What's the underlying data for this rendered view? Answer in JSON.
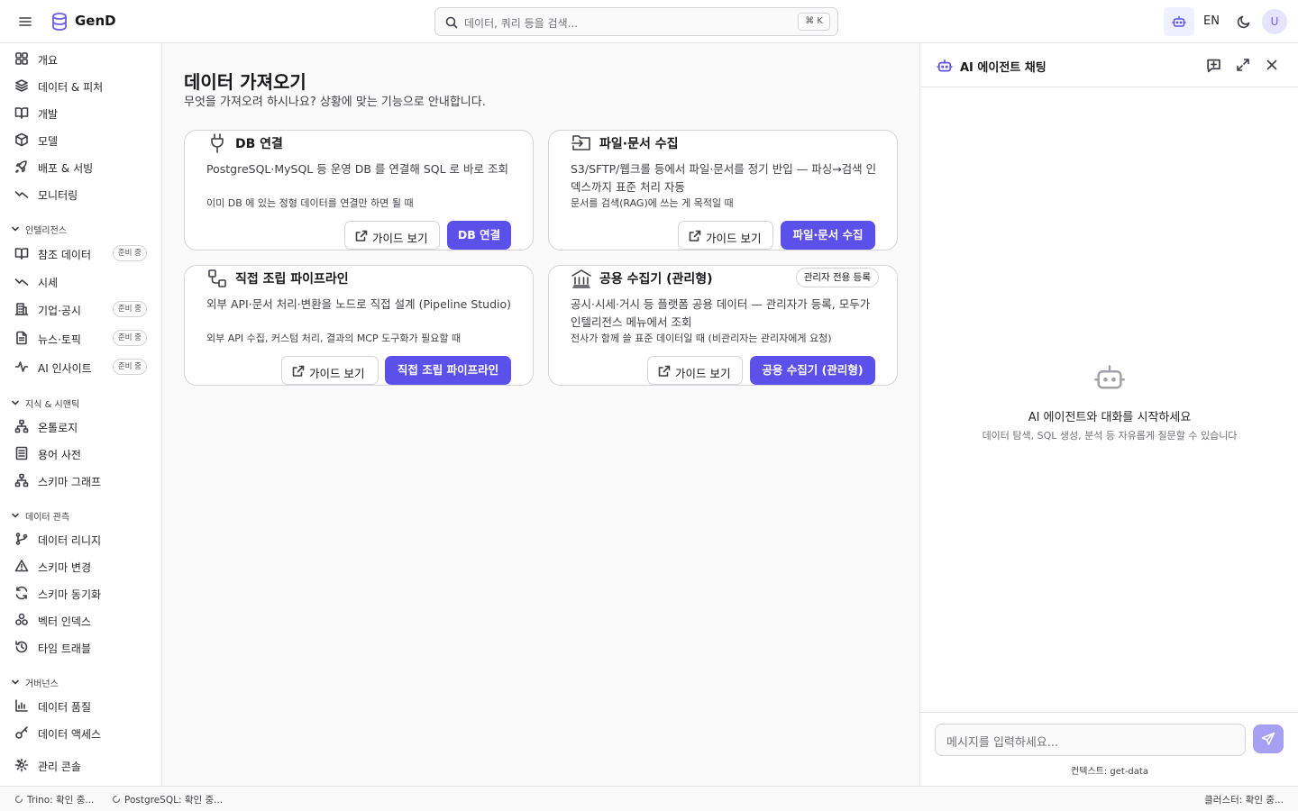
{
  "header": {
    "brand": "GenD",
    "search_placeholder": "데이터, 쿼리 등을 검색...",
    "shortcut": "⌘ K",
    "lang": "EN",
    "avatar": "U"
  },
  "sidebar": {
    "top_items": [
      {
        "label": "개요",
        "icon": "grid-icon"
      },
      {
        "label": "데이터 & 피처",
        "icon": "layers-icon"
      },
      {
        "label": "개발",
        "icon": "book-open-icon"
      },
      {
        "label": "모델",
        "icon": "box-icon"
      },
      {
        "label": "배포 & 서빙",
        "icon": "rocket-icon"
      },
      {
        "label": "모니터링",
        "icon": "activity-icon"
      }
    ],
    "sections": [
      {
        "title": "인텔리전스",
        "items": [
          {
            "label": "참조 데이터",
            "badge": "준비 중"
          },
          {
            "label": "시세",
            "badge": ""
          },
          {
            "label": "기업·공시",
            "badge": "준비 중"
          },
          {
            "label": "뉴스·토픽",
            "badge": "준비 중"
          },
          {
            "label": "AI 인사이트",
            "badge": "준비 중"
          }
        ]
      },
      {
        "title": "지식 & 시맨틱",
        "items": [
          {
            "label": "온톨로지"
          },
          {
            "label": "용어 사전"
          },
          {
            "label": "스키마 그래프"
          }
        ]
      },
      {
        "title": "데이터 관측",
        "items": [
          {
            "label": "데이터 리니지"
          },
          {
            "label": "스키마 변경"
          },
          {
            "label": "스키마 동기화"
          },
          {
            "label": "벡터 인덱스"
          },
          {
            "label": "타임 트래블"
          }
        ]
      },
      {
        "title": "거버넌스",
        "items": [
          {
            "label": "데이터 품질"
          },
          {
            "label": "데이터 액세스"
          }
        ]
      }
    ],
    "admin": "관리 콘솔"
  },
  "main": {
    "title": "데이터 가져오기",
    "subtitle": "무엇을 가져오려 하시나요? 상황에 맞는 기능으로 안내합니다.",
    "guide_label": "가이드 보기",
    "cards": [
      {
        "title": "DB 연결",
        "desc": "PostgreSQL·MySQL 등 운영 DB 를 연결해 SQL 로 바로 조회",
        "hint": "이미 DB 에 있는 정형 데이터를 연결만 하면 될 때",
        "action": "DB 연결"
      },
      {
        "title": "파일·문서 수집",
        "desc": "S3/SFTP/웹크롤 등에서 파일·문서를 정기 반입 — 파싱→검색 인덱스까지 표준 처리 자동",
        "hint": "문서를 검색(RAG)에 쓰는 게 목적일 때",
        "action": "파일·문서 수집"
      },
      {
        "title": "직접 조립 파이프라인",
        "desc": "외부 API·문서 처리·변환을 노드로 직접 설계 (Pipeline Studio)",
        "hint": "외부 API 수집, 커스텀 처리, 결과의 MCP 도구화가 필요할 때",
        "action": "직접 조립 파이프라인"
      },
      {
        "title": "공용 수집기 (관리형)",
        "desc": "공시·시세·거시 등 플랫폼 공용 데이터 — 관리자가 등록, 모두가 인텔리전스 메뉴에서 조회",
        "hint": "전사가 함께 쓸 표준 데이터일 때 (비관리자는 관리자에게 요청)",
        "action": "공용 수집기 (관리형)",
        "badge": "관리자 전용 등록"
      }
    ]
  },
  "chat": {
    "title": "AI 에이전트 채팅",
    "empty_title": "AI 에이전트와 대화를 시작하세요",
    "empty_sub": "데이터 탐색, SQL 생성, 분석 등 자유롭게 질문할 수 있습니다",
    "input_placeholder": "메시지를 입력하세요...",
    "context": "컨텍스트: get-data"
  },
  "status": {
    "trino": "Trino: 확인 중...",
    "postgres": "PostgreSQL: 확인 중...",
    "cluster": "클러스터: 확인 중..."
  },
  "colors": {
    "primary": "#5b50e9",
    "primary_light": "#eef0ff"
  }
}
